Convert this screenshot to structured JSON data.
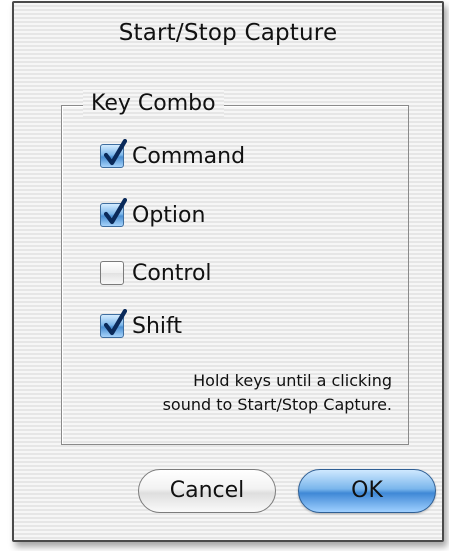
{
  "dialog": {
    "title": "Start/Stop Capture"
  },
  "group": {
    "label": "Key Combo",
    "options": [
      {
        "label": "Command",
        "checked": true
      },
      {
        "label": "Option",
        "checked": true
      },
      {
        "label": "Control",
        "checked": false
      },
      {
        "label": "Shift",
        "checked": true
      }
    ],
    "hint_line1": "Hold keys until a clicking",
    "hint_line2": "sound to Start/Stop Capture."
  },
  "buttons": {
    "cancel_label": "Cancel",
    "ok_label": "OK"
  },
  "colors": {
    "accent": "#4a8fd2",
    "check": "#0a2a5a"
  },
  "icons": {
    "checked": "checkmark-icon"
  }
}
